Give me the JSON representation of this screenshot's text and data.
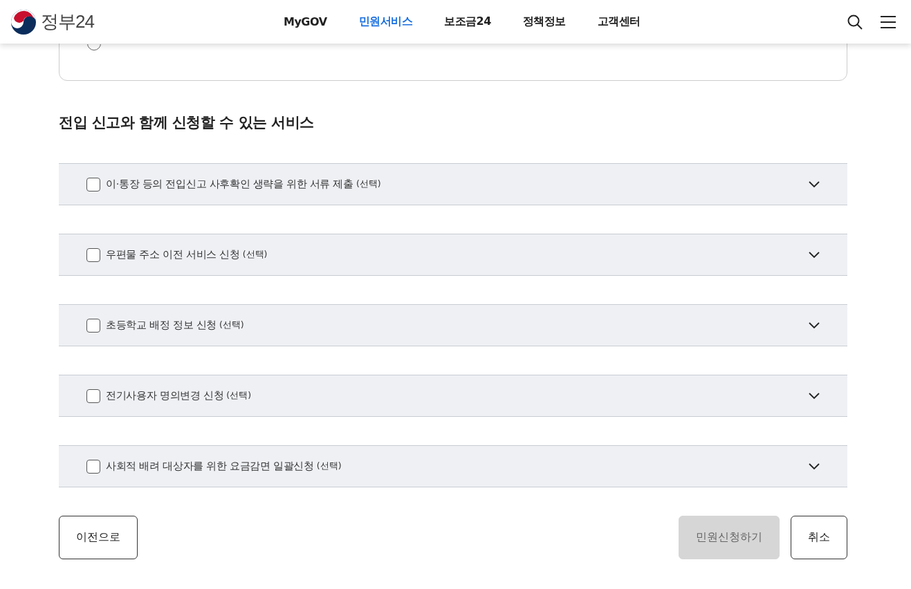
{
  "header": {
    "logo_text": "정부24",
    "nav": [
      {
        "label": "MyGOV",
        "selected": false
      },
      {
        "label": "민원서비스",
        "selected": true
      },
      {
        "label": "보조금24",
        "selected": false
      },
      {
        "label": "정책정보",
        "selected": false
      },
      {
        "label": "고객센터",
        "selected": false
      }
    ]
  },
  "previous_option": {
    "selected": false
  },
  "section_title": "전입 신고와 함께 신청할 수 있는 서비스",
  "services": [
    {
      "label": "이·통장 등의 전입신고 사후확인 생략을 위한 서류 제출",
      "note": "(선택)",
      "checked": false,
      "expanded": false
    },
    {
      "label": "우편물 주소 이전 서비스 신청",
      "note": "(선택)",
      "checked": false,
      "expanded": false
    },
    {
      "label": "초등학교 배정 정보 신청",
      "note": "(선택)",
      "checked": false,
      "expanded": false
    },
    {
      "label": "전기사용자 명의변경 신청",
      "note": "(선택)",
      "checked": false,
      "expanded": false
    },
    {
      "label": "사회적 배려 대상자를 위한 요금감면 일괄신청",
      "note": "(선택)",
      "checked": false,
      "expanded": false
    }
  ],
  "buttons": {
    "back": {
      "label": "이전으로",
      "disabled": false
    },
    "submit": {
      "label": "민원신청하기",
      "disabled": true
    },
    "cancel": {
      "label": "취소",
      "disabled": false
    }
  }
}
